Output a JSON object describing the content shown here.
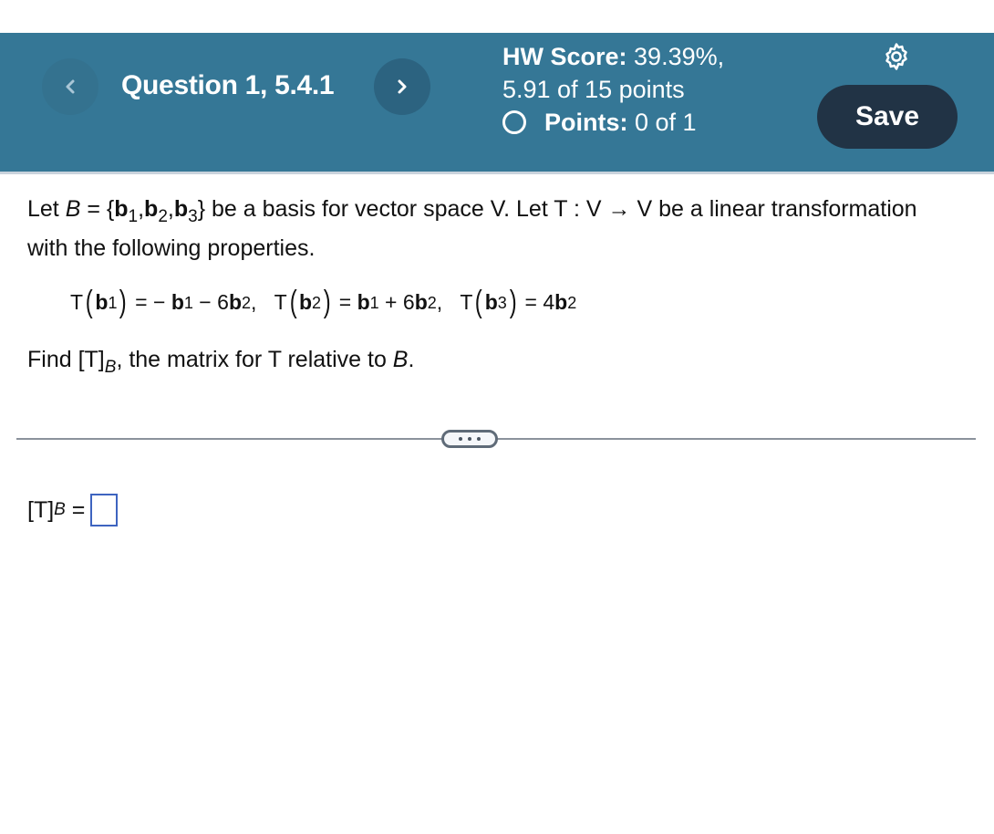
{
  "header": {
    "question_title": "Question 1, 5.4.1",
    "prev_icon": "chevron-left-icon",
    "next_icon": "chevron-right-icon",
    "hw_score_label": "HW Score:",
    "hw_score_value": " 39.39%,",
    "hw_points": "5.91 of 15 points",
    "points_label": "Points:",
    "points_value": " 0 of 1",
    "settings_icon": "gear-icon",
    "save_label": "Save",
    "colors": {
      "header_bg": "#357796",
      "save_bg": "#213345"
    }
  },
  "problem": {
    "line1": {
      "let": "Let ",
      "B": "B",
      "eq": " = {",
      "b": "b",
      "s1": "1",
      "s2": "2",
      "s3": "3",
      "comma": ",",
      "close": "}",
      "rest": " be a basis for vector space V. Let T : V → V be a linear transformation"
    },
    "line2": "with the following properties.",
    "equations": {
      "T": "T",
      "b": "b",
      "lp": "(",
      "rp": ")",
      "e1_rhs_a": " = − ",
      "e1_rhs_b": " − 6",
      "e2_rhs_a": " = ",
      "e2_rhs_b": " + 6",
      "e3_rhs": " = 4",
      "sep": ",   ",
      "one": "1",
      "two": "2",
      "three": "3"
    },
    "find": {
      "pre": "Find [T]",
      "sub": "B",
      "post": ", the matrix for T relative to ",
      "B": "B",
      "end": "."
    }
  },
  "answer": {
    "label": "[T]",
    "sub": "B",
    "eq": " =",
    "value": ""
  },
  "expand_icon": "more-horizontal-icon"
}
